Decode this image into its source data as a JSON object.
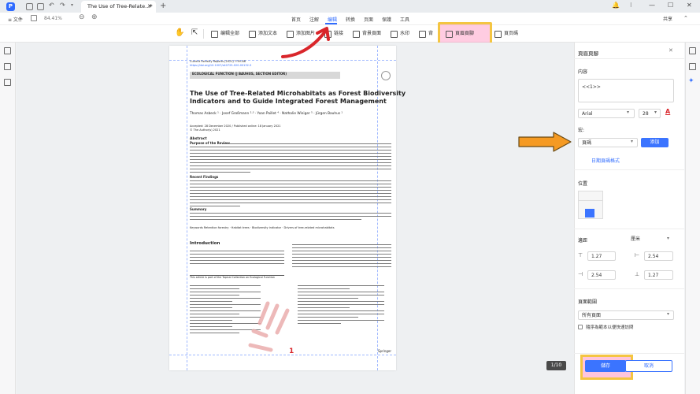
{
  "titlebar": {
    "tab_title": "The Use of Tree-Relate...*",
    "tab_close": "✕",
    "new_tab": "+",
    "controls": [
      "🔔",
      "⁝",
      "—",
      "☐",
      "✕"
    ]
  },
  "menubar": {
    "file": "≡ 文件",
    "zoom": "84.41%",
    "tabs": [
      {
        "label": "首页",
        "active": false
      },
      {
        "label": "注解",
        "active": false
      },
      {
        "label": "编辑",
        "active": true
      },
      {
        "label": "转换",
        "active": false
      },
      {
        "label": "页面",
        "active": false
      },
      {
        "label": "保護",
        "active": false
      },
      {
        "label": "工具",
        "active": false
      }
    ],
    "share": "共享"
  },
  "toolbar": {
    "items": [
      "编辑全部",
      "添加文本",
      "添加图片",
      "链接",
      "背景頁面",
      "水印",
      "背",
      "頁眉頁腳",
      "頁页碼"
    ]
  },
  "document": {
    "journal": "Current Forestry Reports (2021) 7:59–86",
    "doi": "https://doi.org/10.1007/s40725-020-00132-5",
    "section_pill": "ECOLOGICAL FUNCTION (J BAUHUS, SECTION EDITOR)",
    "title_line1": "The Use of Tree-Related Microhabitats as Forest Biodiversity",
    "title_line2": "Indicators and to Guide Integrated Forest Management",
    "authors": "Thomas Asbeck ¹ · Josef Großmann ²·³ · Yoan Paillet ⁴ · Nathalie Winiger ⁵ · Jürgen Bauhus ¹",
    "accepted": "Accepted: 28 December 2020 / Published online: 18 January 2021",
    "copyright": "© The Author(s) 2021",
    "abstract_heading": "Abstract",
    "purpose_label": "Purpose of the Review",
    "recent_label": "Recent Findings",
    "summary_label": "Summary",
    "keywords": "Keywords  Retention forestry · Habitat trees · Biodiversity indicator · Drivers of tree-related microhabitats",
    "intro_heading": "Introduction",
    "topical_note": "This article is part of the Topical Collection on Ecological Function",
    "footer_num": "1",
    "springer": "Springer"
  },
  "page_indicator": "1/10",
  "panel": {
    "title": "頁眉頁腳",
    "content_label": "内容",
    "content_value": "<<1>>",
    "font": "Arial",
    "font_size": "28",
    "macro_label": "宏:",
    "macro_value": "頁碼",
    "add_button": "添加",
    "page_format_link": "日期頁碼格式",
    "position_label": "位置",
    "margin_label": "邊距",
    "unit": "厘米",
    "margins": [
      "1.27",
      "2.54",
      "2.54",
      "1.27"
    ],
    "range_label": "頁面範圍",
    "range_value": "所有頁面",
    "checkbox_label": "隨序為範本以便快速訪問",
    "save": "儲存",
    "cancel": "取消"
  },
  "colors": {
    "accent": "#3b74ff",
    "highlight_border": "#f4c542",
    "highlight_fill": "#ff6eaa",
    "arrow_red": "#d9262b",
    "arrow_orange": "#f59a23"
  }
}
